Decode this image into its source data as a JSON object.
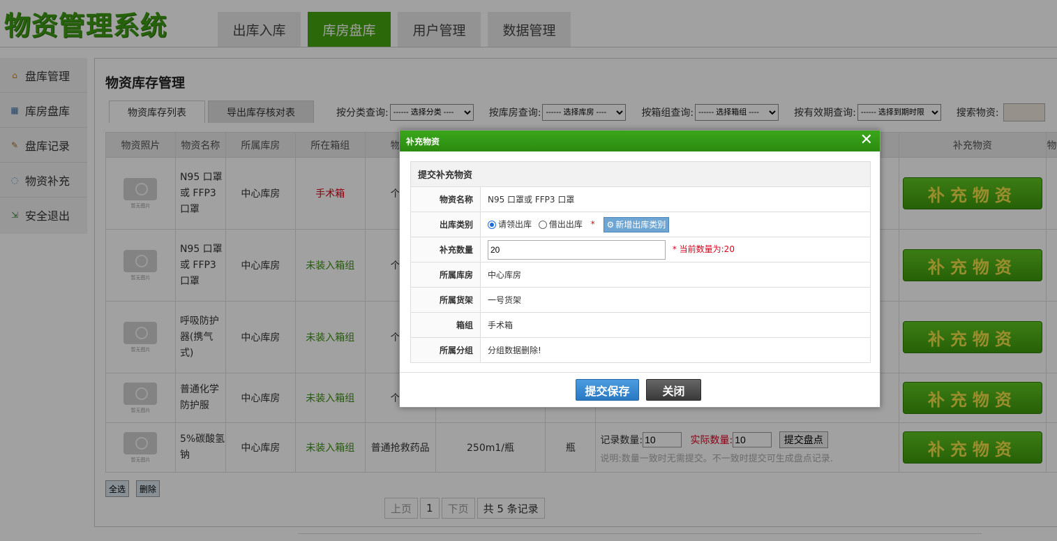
{
  "app": {
    "title": "物资管理系统"
  },
  "topnav": [
    {
      "label": "出库入库"
    },
    {
      "label": "库房盘库"
    },
    {
      "label": "用户管理"
    },
    {
      "label": "数据管理"
    }
  ],
  "sidebar": [
    {
      "label": "盘库管理",
      "icon": "home-icon"
    },
    {
      "label": "库房盘库",
      "icon": "warehouse-icon"
    },
    {
      "label": "盘库记录",
      "icon": "record-icon"
    },
    {
      "label": "物资补充",
      "icon": "chat-icon"
    },
    {
      "label": "安全退出",
      "icon": "logout-icon"
    }
  ],
  "main": {
    "title": "物资库存管理",
    "tabs": [
      {
        "label": "物资库存列表"
      },
      {
        "label": "导出库存核对表"
      }
    ],
    "filters": [
      {
        "label": "按分类查询:",
        "value": "------ 选择分类 ----"
      },
      {
        "label": "按库房查询:",
        "value": "------ 选择库房 ----"
      },
      {
        "label": "按箱组查询:",
        "value": "------ 选择箱组 ----"
      },
      {
        "label": "按有效期查询:",
        "value": "------ 选择到期时限"
      }
    ],
    "search_label": "搜索物资:"
  },
  "table": {
    "headers": [
      "物资照片",
      "物资名称",
      "所属库房",
      "所在箱组",
      "物资",
      "",
      "",
      "",
      "补充物资",
      "物"
    ],
    "photo_caption": "暂无图片",
    "rows": [
      {
        "name": "N95 口罩或 FFP3 口罩",
        "warehouse": "中心库房",
        "box": "手术箱",
        "box_red": true,
        "cat": "个人"
      },
      {
        "name": "N95 口罩或 FFP3 口罩",
        "warehouse": "中心库房",
        "box": "未装入箱组",
        "box_red": false,
        "cat": "个人"
      },
      {
        "name": "呼吸防护器(携气式)",
        "warehouse": "中心库房",
        "box": "未装入箱组",
        "box_red": false,
        "cat": "个人"
      },
      {
        "name": "普通化学防护服",
        "warehouse": "中心库房",
        "box": "未装入箱组",
        "box_red": false,
        "cat": "个人"
      },
      {
        "name": "5%碳酸氢钠",
        "warehouse": "中心库房",
        "box": "未装入箱组",
        "box_red": false,
        "cat": "普通抢救药品",
        "spec": "250m1/瓶",
        "unit": "瓶"
      }
    ],
    "supplement_label": "补充物资",
    "count": {
      "record_label": "记录数量:",
      "record_value": "10",
      "actual_label": "实际数量:",
      "actual_value": "10",
      "submit": "提交盘点",
      "note": "说明:数量一致时无需提交。不一致时提交可生成盘点记录."
    }
  },
  "bulk": {
    "select_all": "全选",
    "delete": "删除"
  },
  "pager": {
    "prev": "上页",
    "page": "1",
    "next": "下页",
    "total": "共 5 条记录"
  },
  "modal": {
    "title": "补充物资",
    "section": "提交补充物资",
    "fields": {
      "name_label": "物资名称",
      "name_value": "N95 口罩或 FFP3 口罩",
      "type_label": "出库类别",
      "type_opt1": "请领出库",
      "type_opt2": "借出出库",
      "new_type": "新增出库类别",
      "qty_label": "补充数量",
      "qty_value": "20",
      "qty_hint": "* 当前数量为:20",
      "wh_label": "所属库房",
      "wh_value": "中心库房",
      "shelf_label": "所属货架",
      "shelf_value": "一号货架",
      "box_label": "箱组",
      "box_value": "手术箱",
      "group_label": "所属分组",
      "group_value": "分组数据删除!"
    },
    "save": "提交保存",
    "close": "关闭"
  }
}
